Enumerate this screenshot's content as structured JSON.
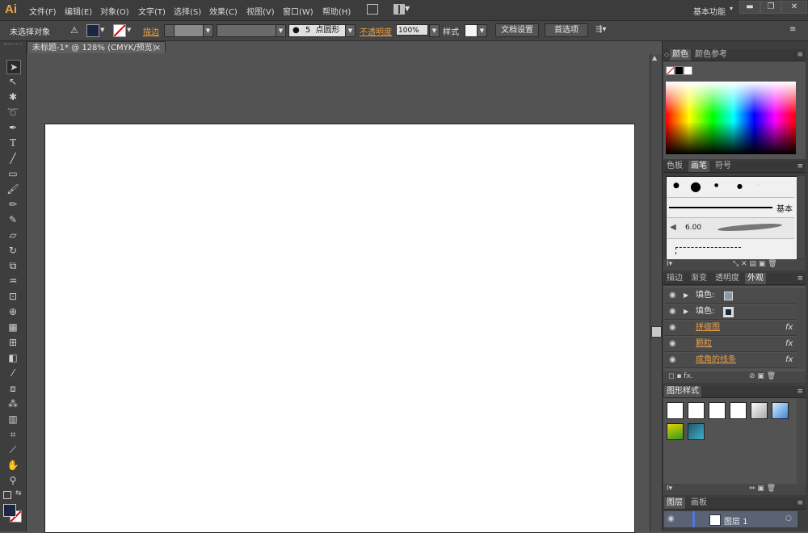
{
  "app": {
    "logo": "Ai",
    "workspace": "基本功能",
    "workspace_arrow": "▾"
  },
  "menu": [
    "文件(F)",
    "编辑(E)",
    "对象(O)",
    "文字(T)",
    "选择(S)",
    "效果(C)",
    "视图(V)",
    "窗口(W)",
    "帮助(H)"
  ],
  "window_controls": {
    "minimize": "▬",
    "restore": "❐",
    "close": "✕"
  },
  "control": {
    "selection": "未选择对象",
    "stroke_label": "描边",
    "brush_size": "5",
    "brush_shape": "点圆形",
    "opacity_label": "不透明度",
    "opacity_value": "100%",
    "style_label": "样式",
    "doc_setup": "文档设置",
    "preferences": "首选项"
  },
  "document": {
    "tab_title": "未标题-1* @ 128% (CMYK/预览)",
    "close": "×"
  },
  "panels": {
    "color": {
      "tabs": [
        "颜色",
        "颜色参考"
      ]
    },
    "brushes": {
      "tabs": [
        "色板",
        "画笔",
        "符号"
      ],
      "basic_label": "基本",
      "brush_size": "6.00"
    },
    "appearance": {
      "tabs": [
        "描边",
        "渐变",
        "透明度",
        "外观"
      ],
      "rows": [
        {
          "label": "填色:",
          "fx": ""
        },
        {
          "label": "填色:",
          "fx": ""
        },
        {
          "label": "拼缀图",
          "fx": "fx"
        },
        {
          "label": "颗粒",
          "fx": "fx"
        },
        {
          "label": "成角的线条",
          "fx": "fx"
        }
      ]
    },
    "graphic_styles": {
      "tabs": [
        "图形样式"
      ]
    },
    "layers": {
      "tabs": [
        "图层",
        "画板"
      ],
      "layer_name": "图层 1"
    }
  }
}
